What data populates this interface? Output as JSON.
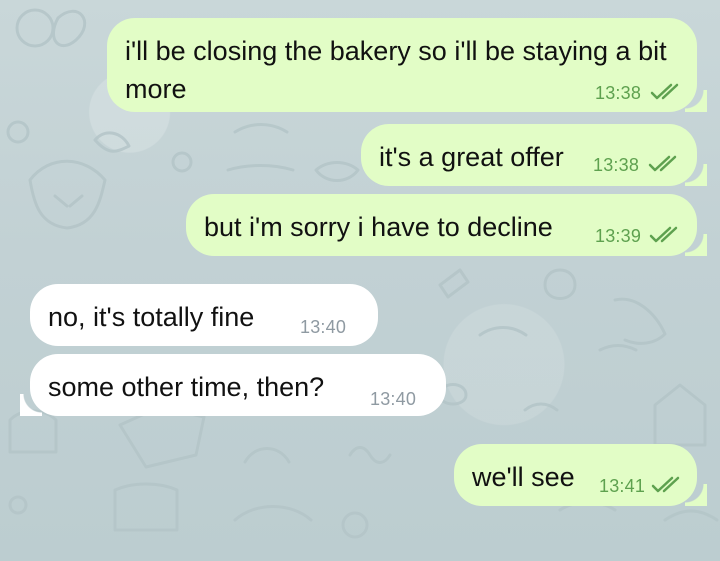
{
  "messages": [
    {
      "direction": "out",
      "text": "i'll be closing the bakery so i'll be staying a bit more",
      "time": "13:38",
      "status_icon": "double-check-icon"
    },
    {
      "direction": "out",
      "text": "it's a great offer",
      "time": "13:38",
      "status_icon": "double-check-icon"
    },
    {
      "direction": "out",
      "text": "but i'm sorry i have to decline",
      "time": "13:39",
      "status_icon": "double-check-icon"
    },
    {
      "direction": "in",
      "text": "no, it's totally fine",
      "time": "13:40"
    },
    {
      "direction": "in",
      "text": "some other time, then?",
      "time": "13:40"
    },
    {
      "direction": "out",
      "text": "we'll see",
      "time": "13:41",
      "status_icon": "double-check-icon"
    }
  ],
  "colors": {
    "outgoing_bubble": "#e2fdc6",
    "incoming_bubble": "#ffffff",
    "outgoing_time": "#5ea14f",
    "incoming_time": "#8f9aa2",
    "wallpaper": "#c5d3d6"
  }
}
